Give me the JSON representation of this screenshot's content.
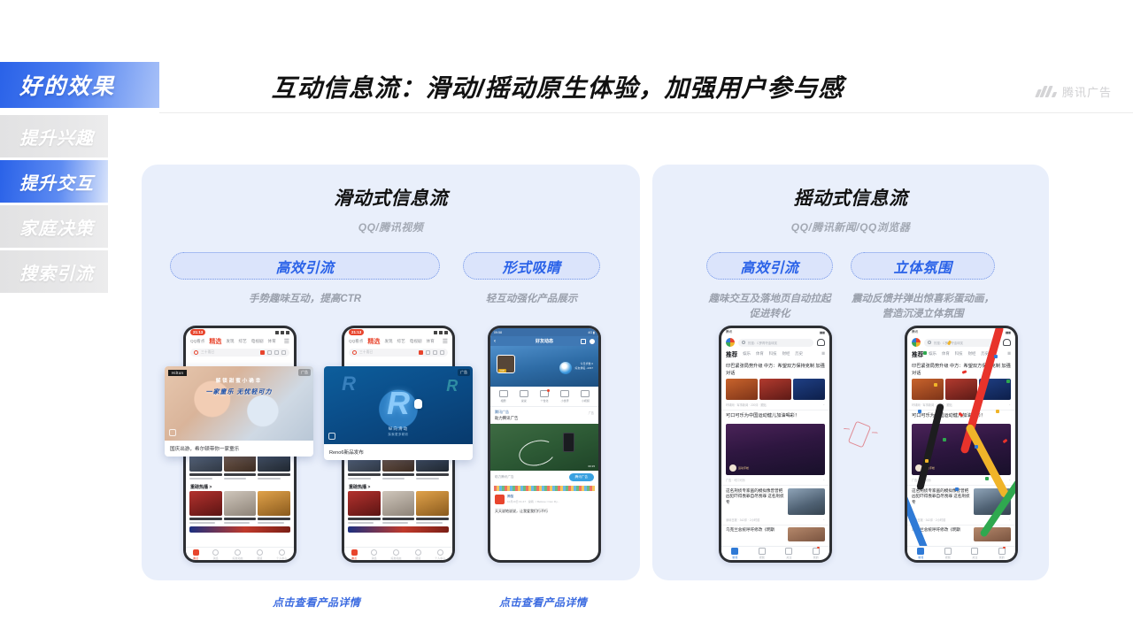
{
  "header": {
    "title": "互动信息流：滑动/摇动原生体验，加强用户参与感",
    "brand": "腾讯广告"
  },
  "sidebar": {
    "hero_label": "好的效果",
    "items": [
      {
        "label": "提升兴趣",
        "active": false
      },
      {
        "label": "提升交互",
        "active": true
      },
      {
        "label": "家庭决策",
        "active": false
      },
      {
        "label": "搜索引流",
        "active": false
      }
    ]
  },
  "panels": [
    {
      "title": "滑动式信息流",
      "subtitle": "QQ/腾讯视频",
      "pills": [
        {
          "label": "高效引流",
          "caption": "手势趣味互动，提高CTR"
        },
        {
          "label": "形式吸睛",
          "caption": "轻互动强化产品展示"
        }
      ]
    },
    {
      "title": "摇动式信息流",
      "subtitle": "QQ/腾讯新闻/QQ浏览器",
      "pills": [
        {
          "label": "高效引流",
          "caption": "趣味交互及落地页自动拉起\n促进转化"
        },
        {
          "label": "立体氛围",
          "caption": "震动反馈并弹出惊喜彩蛋动画，\n营造沉浸立体氛围"
        }
      ]
    }
  ],
  "footer_links": [
    "点击查看产品详情",
    "点击查看产品详情"
  ],
  "phones": {
    "qq_feed": {
      "status_time": "21:13",
      "nav": [
        "QQ看点",
        "精选",
        "发现",
        "综艺",
        "电视剧",
        "体育"
      ],
      "nav_selected": "精选",
      "search_placeholder": "三十而已",
      "section_title": "重磅热播 >",
      "cards_row1": [
        {
          "title": "脱口秀大会 第4季",
          "meta": "你看过你懂了"
        },
        {
          "title": "烈火·重案",
          "meta": "预告已过94%"
        },
        {
          "title": "魔道祖师",
          "meta": "预告已过"
        }
      ],
      "cards_row2": [
        {
          "title": "脱口秀大4·李诞爆梗实录",
          "meta": "大张伟王勉杨笠吉克广播"
        },
        {
          "title": "只是结婚的关系",
          "meta": "王左佐王子奇不行不相识"
        },
        {
          "title": "您好！",
          "meta": "预告·起"
        }
      ],
      "tabbar": [
        "看点",
        "消息",
        "好友动态",
        "频道",
        "个人中心"
      ]
    },
    "ad_card_1": {
      "brand": "Hilton",
      "ad_tag": "广告",
      "headline_small": "解锁甜蜜小确幸",
      "headline_big": "一家童乐 无忧轻可力",
      "caption": "国庆出游，希尔顿带你一家童乐"
    },
    "ad_card_2": {
      "ad_tag": "广告",
      "logo_letter": "R",
      "sub": "纵向滑动",
      "sub2": "探索更多精彩",
      "caption": "Reno6新品发布"
    },
    "qq_moments": {
      "title": "好友动态",
      "quick_icons": [
        "相册",
        "说说",
        "个性化",
        "小世界",
        "小视频"
      ],
      "ad_account": "腾讯广告",
      "ad_tag": "广告",
      "ad_text": "助力腾讯广告",
      "cta_left": "助力腾讯广告",
      "cta_button": "腾讯广告",
      "comment_name": "腾酷",
      "comment_meta": "10月19日 01:47  · 说唱 · I Believe I Can Fly...",
      "last_text": "天天说地说说，让我爱我们行不行"
    },
    "tencent_news": {
      "app_name": "腾讯",
      "search_hot": "热搜：C罗再夺金球奖",
      "tabs": [
        "推荐",
        "娱乐",
        "体育",
        "科技",
        "财经",
        "历史"
      ],
      "tab_selected": "推荐",
      "headline_1": "印巴紧张局势升级 中方：希望双方保持克制 加强对话",
      "meta_1": "环球网 · 军事新闻 · 220评 · 跟贴",
      "headline_2": "可口可乐为中国运动健儿加油喝彩！",
      "video_overlay": "运动手帐",
      "ad_label": "广告",
      "meta_2": "广告 · 可口可乐",
      "headline_3": "这名刑侦专家画的模拟像曾曾把凶犯吓得畏罪自尽畏罪 这名刑侦专",
      "meta_3": "深圳日报 · 342评 · 2小时前",
      "headline_4": "乌克兰总统呼吁修改《明斯",
      "tabbar": [
        "新闻",
        "视频",
        "关注",
        "我的"
      ]
    }
  },
  "colors": {
    "accent_blue": "#2a62e8",
    "panel_bg": "#e9effb",
    "pill_bg": "#dbe4fb",
    "link_blue": "#3a6ae0",
    "caption_gray": "#9aa0ac"
  }
}
